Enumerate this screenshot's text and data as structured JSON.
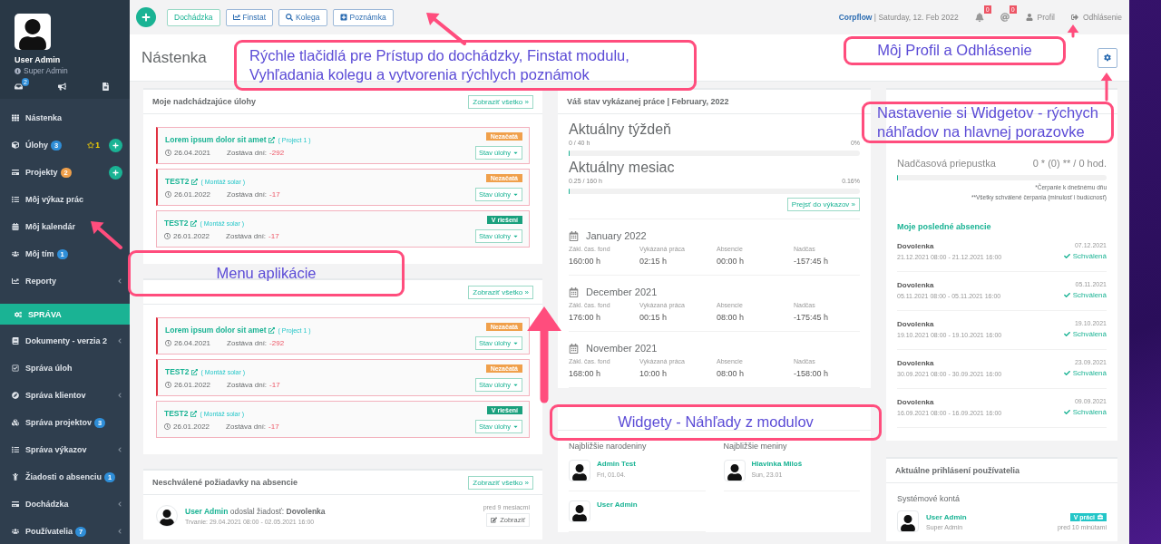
{
  "sidebar": {
    "user": {
      "name": "User Admin",
      "role": "Super Admin",
      "icon_badge": "2"
    },
    "menu": [
      {
        "kind": "item",
        "label": "Nástenka",
        "expandable": false
      },
      {
        "kind": "item",
        "label": "Úlohy",
        "badge": "3",
        "color": "#2f8ed8",
        "star": "1",
        "add": true,
        "expandable": false
      },
      {
        "kind": "item",
        "label": "Projekty",
        "badge": "2",
        "color": "#f0a04b",
        "add": true,
        "expandable": false
      },
      {
        "kind": "item",
        "label": "Môj výkaz prác",
        "expandable": false
      },
      {
        "kind": "item",
        "label": "Môj kalendár",
        "expandable": false
      },
      {
        "kind": "item",
        "label": "Môj tím",
        "badge": "1",
        "color": "#2f8ed8",
        "expandable": false
      },
      {
        "kind": "item",
        "label": "Reporty",
        "expandable": true
      },
      {
        "kind": "section",
        "label": "SPRÁVA"
      },
      {
        "kind": "item",
        "label": "Dokumenty - verzia 2",
        "expandable": true
      },
      {
        "kind": "item",
        "label": "Správa úloh",
        "expandable": false
      },
      {
        "kind": "item",
        "label": "Správa klientov",
        "expandable": true
      },
      {
        "kind": "item",
        "label": "Správa projektov",
        "badge": "3",
        "color": "#2f8ed8",
        "expandable": false
      },
      {
        "kind": "item",
        "label": "Správa výkazov",
        "expandable": true
      },
      {
        "kind": "item",
        "label": "Žiadosti o absenciu",
        "badge": "1",
        "color": "#2f8ed8",
        "expandable": false
      },
      {
        "kind": "item",
        "label": "Dochádzka",
        "expandable": true
      },
      {
        "kind": "item",
        "label": "Používatelia",
        "badge": "7",
        "color": "#2f8ed8",
        "expandable": true
      }
    ]
  },
  "topbar": {
    "quick_buttons": [
      {
        "kind": "plain",
        "label": "Dochádzka"
      },
      {
        "kind": "chart",
        "label": "Finstat"
      },
      {
        "kind": "search",
        "label": "Kolega"
      },
      {
        "kind": "note",
        "label": "Poznámka"
      }
    ],
    "brand": "Corpflow",
    "date": "| Saturday, 12. Feb 2022",
    "notifications": [
      {
        "kind": "bell",
        "count": "0"
      },
      {
        "kind": "at",
        "count": "0"
      }
    ],
    "profile": "Profil",
    "logout": "Odhlásenie"
  },
  "page": {
    "title": "Nástenka"
  },
  "task_widgets": [
    {
      "title": "Moje nadchádzajúce úlohy",
      "link": "Zobraziť všetko »",
      "tasks": [
        {
          "title": "Lorem ipsum dolor sit amet",
          "project": "( Project 1 )",
          "date": "26.04.2021",
          "remaining_label": "Zostáva dní:",
          "remaining": "-292",
          "status": "Nezačatá",
          "color": "#f0a04b",
          "overdue": true,
          "action": "Stav úlohy"
        },
        {
          "title": "TEST2",
          "project": "( Montáž solar )",
          "date": "26.01.2022",
          "remaining_label": "Zostáva dní:",
          "remaining": "-17",
          "status": "Nezačatá",
          "color": "#f0a04b",
          "overdue": true,
          "action": "Stav úlohy"
        },
        {
          "title": "TEST2",
          "project": "( Montáž solar )",
          "date": "26.01.2022",
          "remaining_label": "Zostáva dní:",
          "remaining": "-17",
          "status": "V riešení",
          "color": "#1aa07d",
          "overdue": false,
          "action": "Stav úlohy"
        }
      ]
    },
    {
      "link": "Zobraziť všetko »",
      "tasks": [
        {
          "title": "Lorem ipsum dolor sit amet",
          "project": "( Project 1 )",
          "date": "26.04.2021",
          "remaining_label": "Zostáva dní:",
          "remaining": "-292",
          "status": "Nezačatá",
          "color": "#f0a04b",
          "overdue": true,
          "action": "Stav úlohy"
        },
        {
          "title": "TEST2",
          "project": "( Montáž solar )",
          "date": "26.01.2022",
          "remaining_label": "Zostáva dní:",
          "remaining": "-17",
          "status": "Nezačatá",
          "color": "#f0a04b",
          "overdue": true,
          "action": "Stav úlohy"
        },
        {
          "title": "TEST2",
          "project": "( Montáž solar )",
          "date": "26.01.2022",
          "remaining_label": "Zostáva dní:",
          "remaining": "-17",
          "status": "V riešení",
          "color": "#1aa07d",
          "overdue": false,
          "action": "Stav úlohy"
        }
      ]
    }
  ],
  "absence_requests": {
    "title": "Neschválené požiadavky na absencie",
    "link": "Zobraziť všetko »",
    "items": [
      {
        "user": "User Admin",
        "message": "odoslal žiadosť:",
        "type": "Dovolenka",
        "duration": "Trvanie: 29.04.2021 08:00 - 02.05.2021 16:00",
        "time": "pred 9 mesiacmi",
        "action": "Zobraziť"
      }
    ]
  },
  "work_status": {
    "title": "Váš stav vykázanej práce | February, 2022",
    "progress": [
      {
        "label": "Aktuálny týždeň",
        "hours": "0 / 40 h",
        "percent": "0%",
        "level": 0
      },
      {
        "label": "Aktuálny mesiac",
        "hours": "0.25 / 160 h",
        "percent": "0.16%",
        "level": 0.0016
      }
    ],
    "link": "Prejsť do výkazov »",
    "months": [
      {
        "month": "January 2022",
        "columns": [
          "Zákl. čas. fond",
          "Vykázaná práca",
          "Absencie",
          "Nadčas"
        ],
        "values": [
          "160:00 h",
          "02:15 h",
          "00:00 h",
          "-157:45 h"
        ]
      },
      {
        "month": "December 2021",
        "columns": [
          "Zákl. čas. fond",
          "Vykázaná práca",
          "Absencie",
          "Nadčas"
        ],
        "values": [
          "176:00 h",
          "00:15 h",
          "08:00 h",
          "-175:45 h"
        ]
      },
      {
        "month": "November 2021",
        "columns": [
          "Zákl. čas. fond",
          "Vykázaná práca",
          "Absencie",
          "Nadčas"
        ],
        "values": [
          "168:00 h",
          "10:00 h",
          "08:00 h",
          "-158:00 h"
        ]
      }
    ]
  },
  "colleagues": {
    "birthdays_title": "Najbližšie narodeniny",
    "birthdays": [
      {
        "name": "Admin Test",
        "date": "Fri, 01.04."
      },
      {
        "name": "User Admin"
      }
    ],
    "namedays_title": "Najbližšie meniny",
    "namedays": [
      {
        "name": "Hlavinka Miloš",
        "date": "Sun, 23.01"
      }
    ]
  },
  "absences": {
    "quota": {
      "label": "Nadčasová priepustka",
      "value": "0 * (0) ** / 0 hod.",
      "level": 0
    },
    "notes": [
      "*Čerpanie k dnešnému dňu",
      "**Všetky schválené čerpania (minulosť i budúcnosť)"
    ],
    "recent_title": "Moje posledné absencie",
    "recent": [
      {
        "type": "Dovolenka",
        "range": "21.12.2021 08:00 - 21.12.2021 16:00",
        "date": "07.12.2021",
        "status": "Schválená"
      },
      {
        "type": "Dovolenka",
        "range": "05.11.2021 08:00 - 05.11.2021 16:00",
        "date": "05.11.2021",
        "status": "Schválená"
      },
      {
        "type": "Dovolenka",
        "range": "19.10.2021 08:00 - 19.10.2021 16:00",
        "date": "19.10.2021",
        "status": "Schválená"
      },
      {
        "type": "Dovolenka",
        "range": "30.09.2021 08:00 - 30.09.2021 16:00",
        "date": "23.09.2021",
        "status": "Schválená"
      },
      {
        "type": "Dovolenka",
        "range": "16.09.2021 08:00 - 16.09.2021 16:00",
        "date": "09.09.2021",
        "status": "Schválená"
      }
    ]
  },
  "online_users": {
    "title": "Aktuálne prihlásení používatelia",
    "group": "Systémové kontá",
    "users": [
      {
        "name": "User Admin",
        "role": "Super Admin",
        "status": "V práci",
        "time": "pred 10 minútami"
      }
    ]
  },
  "annotations": [
    {
      "text": "Rýchle tlačidlá pre Prístup do dochádzky, Finstat modulu, Vyhľadania kolegu a vytvorenia rýchlych poznámok"
    },
    {
      "text": "Môj Profil a Odhlásenie"
    },
    {
      "text": "Nastavenie si Widgetov - rýchych náhľadov na hlavnej porazovke"
    },
    {
      "text": "Menu aplikácie"
    },
    {
      "text": "Widgety - Náhľady z modulov"
    }
  ]
}
